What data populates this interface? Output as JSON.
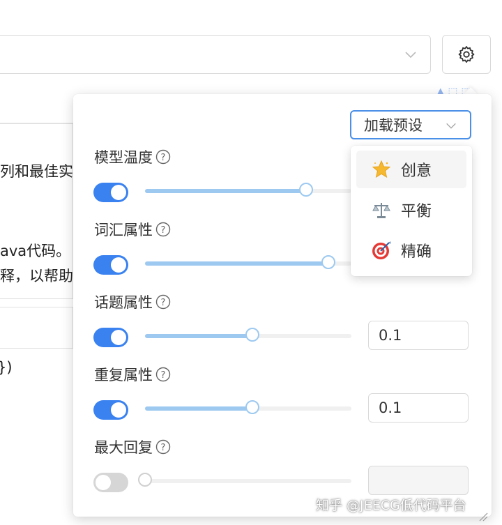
{
  "background": {
    "lines": [
      "列和最佳实",
      "ava代码。",
      "释，以帮助",
      "})"
    ]
  },
  "preset": {
    "label": "加载预设",
    "options": [
      {
        "label": "创意",
        "icon": "star-icon",
        "active": true
      },
      {
        "label": "平衡",
        "icon": "scale-icon",
        "active": false
      },
      {
        "label": "精确",
        "icon": "target-icon",
        "active": false
      }
    ]
  },
  "params": [
    {
      "label": "模型温度",
      "enabled": true,
      "level": 0.78,
      "value": ""
    },
    {
      "label": "词汇属性",
      "enabled": true,
      "level": 0.89,
      "value": ""
    },
    {
      "label": "话题属性",
      "enabled": true,
      "level": 0.52,
      "value": "0.1"
    },
    {
      "label": "重复属性",
      "enabled": true,
      "level": 0.52,
      "value": "0.1"
    },
    {
      "label": "最大回复",
      "enabled": false,
      "level": 0.0,
      "value": ""
    }
  ],
  "watermark": "知乎 @JEECG低代码平台",
  "colors": {
    "accent": "#3a82f0",
    "slider_fill": "#9dc9f0",
    "toggle_off": "#d6d6d6"
  }
}
